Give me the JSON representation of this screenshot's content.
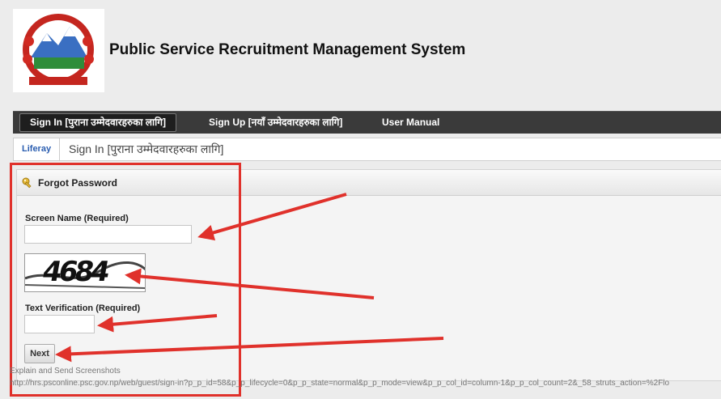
{
  "header": {
    "site_title": "Public Service Recruitment Management System"
  },
  "nav": {
    "items": [
      {
        "label": "Sign In [पुराना उम्मेदवारहरुका लागि]"
      },
      {
        "label": "Sign Up [नयाँ उम्मेदवारहरुका लागि]"
      },
      {
        "label": "User Manual"
      }
    ]
  },
  "breadcrumb": {
    "home": "Liferay",
    "current": "Sign In [पुराना उम्मेदवारहरुका लागि]"
  },
  "portlet": {
    "title": "Forgot Password",
    "screen_name_label": "Screen Name (Required)",
    "screen_name_value": "",
    "captcha_text": "4684",
    "text_verification_label": "Text Verification (Required)",
    "text_verification_value": "",
    "next_label": "Next"
  },
  "statusbar": {
    "note": "Explain and Send Screenshots",
    "url": "http://hrs.psconline.psc.gov.np/web/guest/sign-in?p_p_id=58&p_p_lifecycle=0&p_p_state=normal&p_p_mode=view&p_p_col_id=column-1&p_p_col_count=2&_58_struts_action=%2Flo"
  },
  "colors": {
    "annotation": "#e0312b",
    "nav_bg": "#3a3a3a"
  }
}
